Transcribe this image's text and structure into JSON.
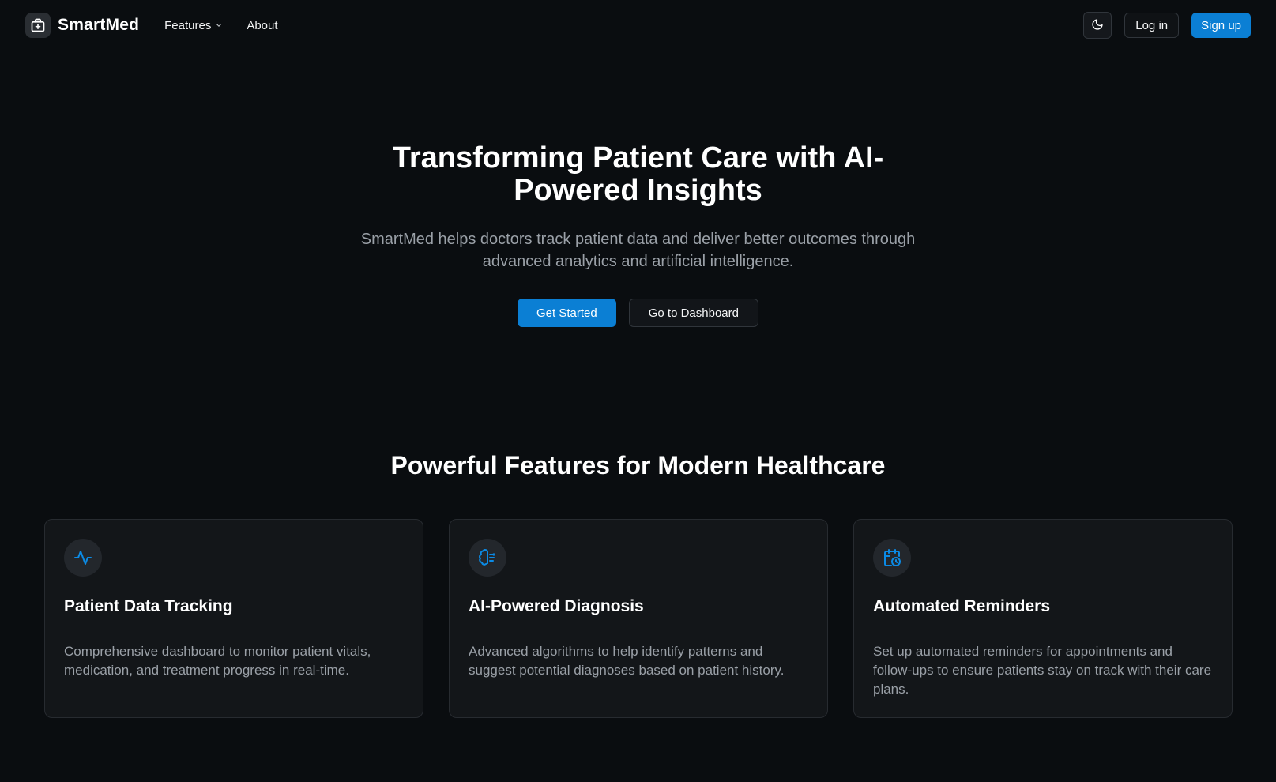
{
  "nav": {
    "brand": "SmartMed",
    "links": [
      {
        "label": "Features",
        "has_dropdown": true
      },
      {
        "label": "About",
        "has_dropdown": false
      }
    ],
    "theme_toggle_icon": "moon-icon",
    "login_label": "Log in",
    "signup_label": "Sign up"
  },
  "hero": {
    "title": "Transforming Patient Care with AI-Powered Insights",
    "subtitle": "SmartMed helps doctors track patient data and deliver better outcomes through advanced analytics and artificial intelligence.",
    "primary_cta": "Get Started",
    "secondary_cta": "Go to Dashboard"
  },
  "features": {
    "title": "Powerful Features for Modern Healthcare",
    "items": [
      {
        "icon": "activity-icon",
        "title": "Patient Data Tracking",
        "description": "Comprehensive dashboard to monitor patient vitals, medication, and treatment progress in real-time."
      },
      {
        "icon": "brain-icon",
        "title": "AI-Powered Diagnosis",
        "description": "Advanced algorithms to help identify patterns and suggest potential diagnoses based on patient history."
      },
      {
        "icon": "calendar-clock-icon",
        "title": "Automated Reminders",
        "description": "Set up automated reminders for appointments and follow-ups to ensure patients stay on track with their care plans."
      }
    ]
  },
  "colors": {
    "background": "#0a0d10",
    "accent": "#0b7fd4",
    "card": "#131619",
    "muted_text": "#9aa0a7"
  }
}
